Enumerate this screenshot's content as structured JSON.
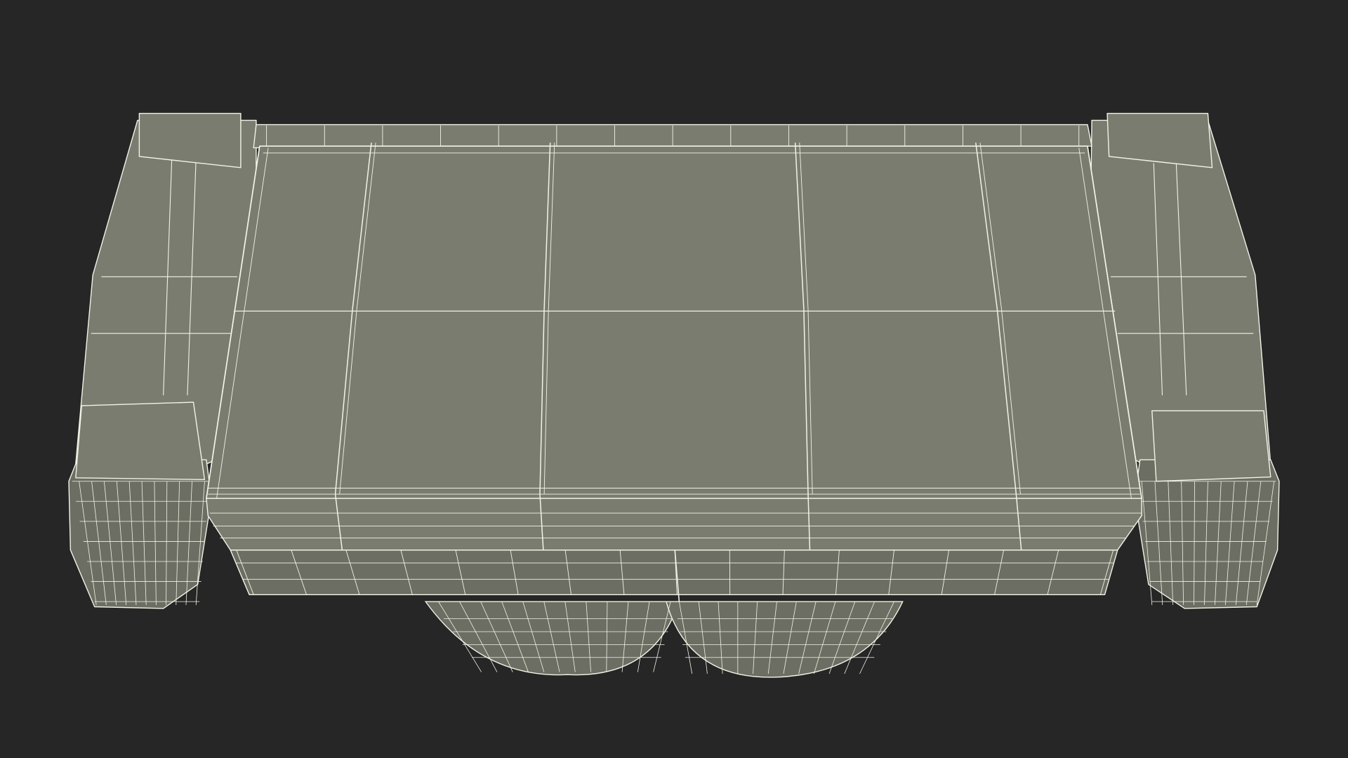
{
  "scene": {
    "subject": "sofa-wireframe-render",
    "background_color": "#262626",
    "surface_color": "#7b7c70",
    "surface_dark_color": "#6d6e63",
    "wire_color": "#f2f3e6"
  }
}
